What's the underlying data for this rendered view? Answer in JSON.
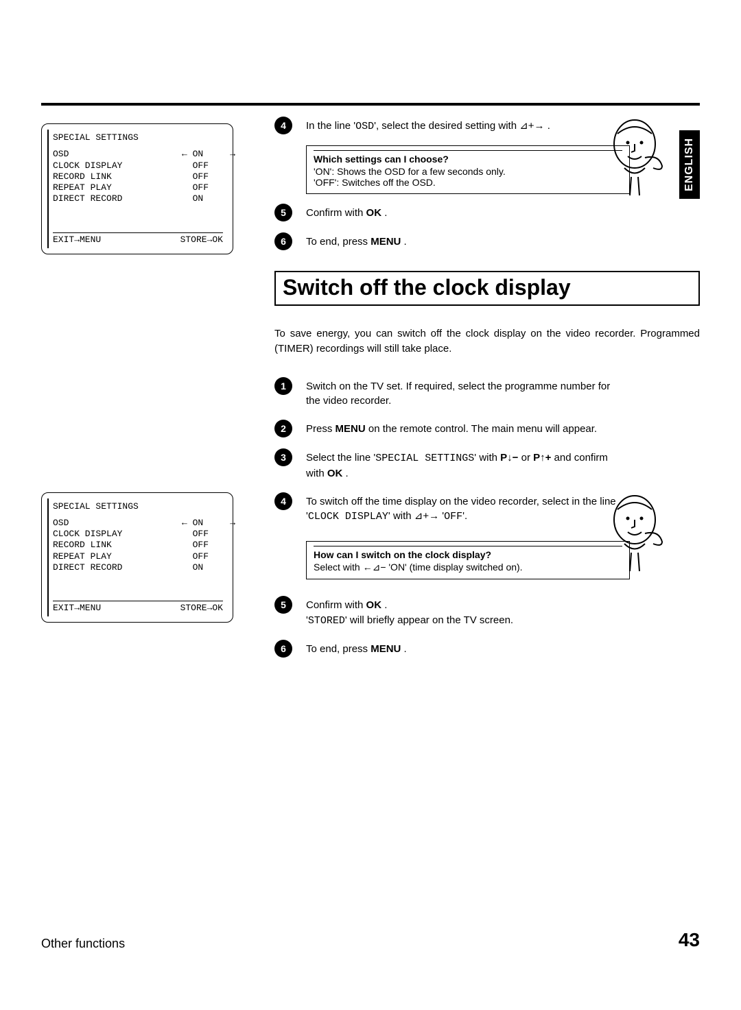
{
  "lang_tab": "ENGLISH",
  "osd1": {
    "title": "SPECIAL SETTINGS",
    "rows": [
      {
        "label": "OSD",
        "val": "← ON     →"
      },
      {
        "label": "CLOCK DISPLAY",
        "val": "  OFF"
      },
      {
        "label": "RECORD LINK",
        "val": "  OFF"
      },
      {
        "label": "REPEAT PLAY",
        "val": "  OFF"
      },
      {
        "label": "DIRECT RECORD",
        "val": "  ON"
      }
    ],
    "footer_left": "EXIT→MENU",
    "footer_right": "STORE→OK"
  },
  "osd2": {
    "title": "SPECIAL SETTINGS",
    "rows": [
      {
        "label": "OSD",
        "val": "← ON     →"
      },
      {
        "label": "CLOCK DISPLAY",
        "val": "  OFF"
      },
      {
        "label": "RECORD LINK",
        "val": "  OFF"
      },
      {
        "label": "REPEAT PLAY",
        "val": "  OFF"
      },
      {
        "label": "DIRECT RECORD",
        "val": "  ON"
      }
    ],
    "footer_left": "EXIT→MENU",
    "footer_right": "STORE→OK"
  },
  "top_steps": {
    "s4_a": "In the line '",
    "s4_osd": "OSD",
    "s4_b": "', select the desired setting with  ⊿+→ .",
    "tip_title": "Which settings can I choose?",
    "tip_line1": "'ON': Shows the OSD for a few seconds only.",
    "tip_line2": "'OFF': Switches off the OSD.",
    "s5_a": "Confirm with ",
    "s5_key": "OK",
    "s5_b": " .",
    "s6_a": "To end, press ",
    "s6_key": "MENU",
    "s6_b": " ."
  },
  "section_title": "Switch off the clock display",
  "intro": "To save energy, you can switch off the clock display on the video recorder. Programmed (TIMER) recordings will still take place.",
  "steps2": {
    "s1": "Switch on the TV set. If required, select the programme number for the video recorder.",
    "s2_a": "Press ",
    "s2_key": "MENU",
    "s2_b": " on the remote control. The main menu will appear.",
    "s3_a": "Select the line '",
    "s3_code": "SPECIAL SETTINGS",
    "s3_b": "' with ",
    "s3_k1": "P↓−",
    "s3_c": " or ",
    "s3_k2": "P↑+",
    "s3_d": " and confirm with ",
    "s3_ok": "OK",
    "s3_e": " .",
    "s4_a": "To switch off the time display on the video recorder, select in the line '",
    "s4_code": "CLOCK DISPLAY",
    "s4_b": "' with  ⊿+→  '",
    "s4_off": "OFF",
    "s4_c": "'.",
    "tip2_title": "How can I switch on the clock display?",
    "tip2_line": "Select with  ←⊿−  'ON' (time display switched on).",
    "s5_a": "Confirm with ",
    "s5_key": "OK",
    "s5_b": " .",
    "s5_c": "'",
    "s5_stored": "STORED",
    "s5_d": "' will briefly appear on the TV screen.",
    "s6_a": "To end, press ",
    "s6_key": "MENU",
    "s6_b": " ."
  },
  "footer_left": "Other functions",
  "footer_right": "43"
}
